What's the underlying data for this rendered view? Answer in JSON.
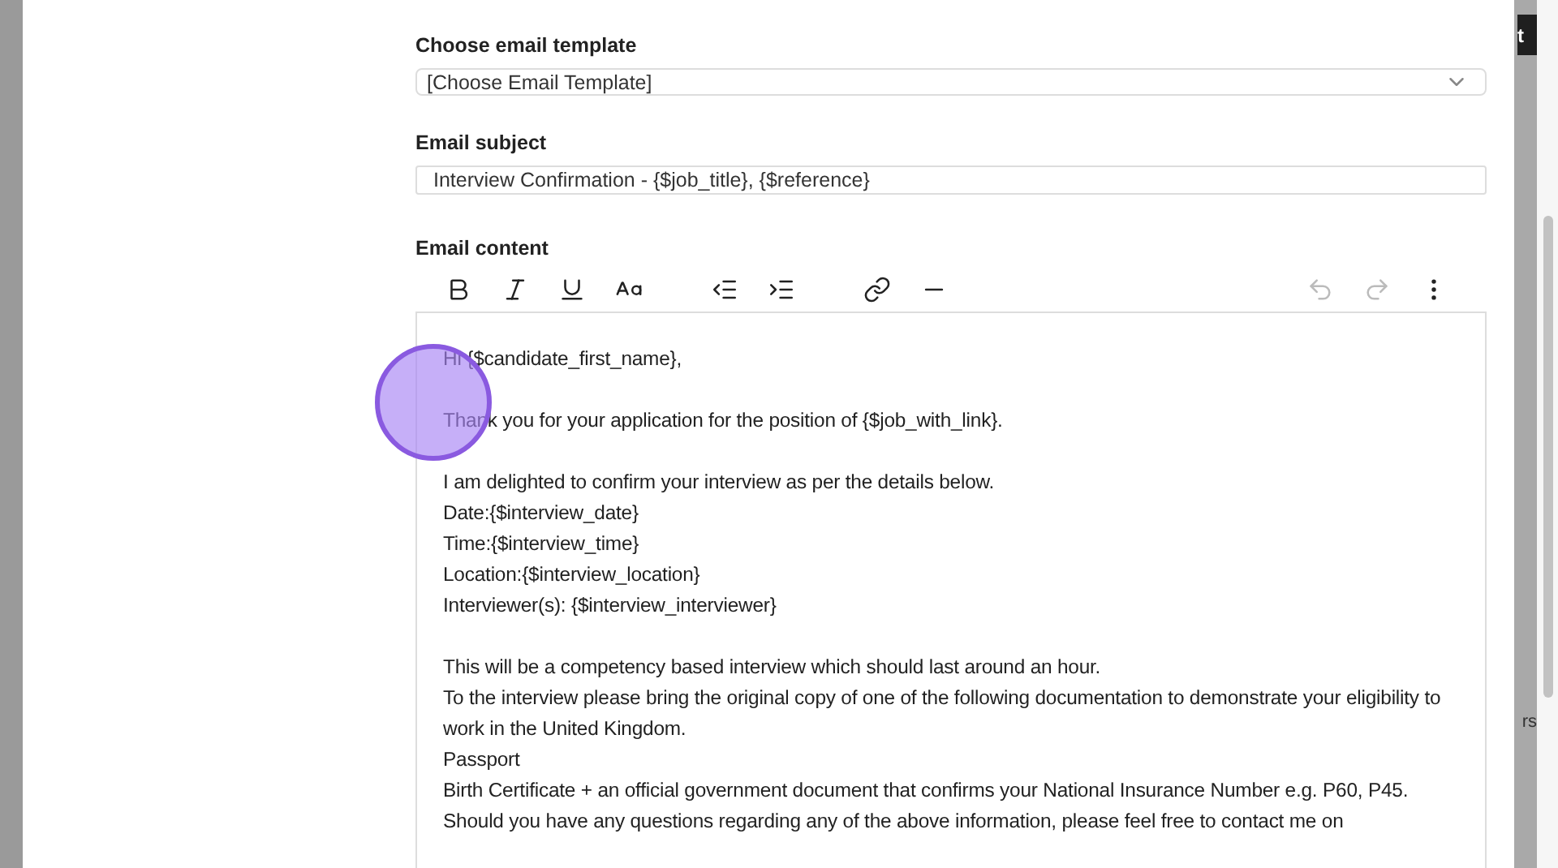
{
  "template": {
    "label": "Choose email template",
    "value": "[Choose Email Template]"
  },
  "subject": {
    "label": "Email subject",
    "value": "Interview Confirmation - {$job_title}, {$reference}"
  },
  "content": {
    "label": "Email content",
    "toolbar": [
      {
        "kind": "bold",
        "disabled": false
      },
      {
        "kind": "italic",
        "disabled": false
      },
      {
        "kind": "underline",
        "disabled": false
      },
      {
        "kind": "font-size",
        "disabled": false
      },
      {
        "kind": "outdent",
        "disabled": false
      },
      {
        "kind": "indent",
        "disabled": false
      },
      {
        "kind": "link",
        "disabled": false
      },
      {
        "kind": "rule",
        "disabled": false
      },
      {
        "kind": "undo",
        "disabled": true
      },
      {
        "kind": "redo",
        "disabled": true
      },
      {
        "kind": "more",
        "disabled": false
      }
    ],
    "paragraphs": [
      [
        "Hi {$candidate_first_name},"
      ],
      [
        "Thank you for your application for the position of {$job_with_link}."
      ],
      [
        "I am delighted to confirm your interview as per the details below.",
        "Date:{$interview_date}",
        "Time:{$interview_time}",
        "Location:{$interview_location}",
        "Interviewer(s): {$interview_interviewer}"
      ],
      [
        "This will be a competency based interview which should last around an hour.",
        "To the interview please bring the original copy of one of the following documentation to demonstrate your eligibility to work in the United Kingdom.",
        "Passport",
        "Birth Certificate + an official government document that confirms your National Insurance Number e.g. P60, P45.",
        "Should you have any questions regarding any of the above information, please feel free to contact me on"
      ]
    ]
  },
  "background": {
    "button": "t",
    "text_fragment": "rs"
  }
}
